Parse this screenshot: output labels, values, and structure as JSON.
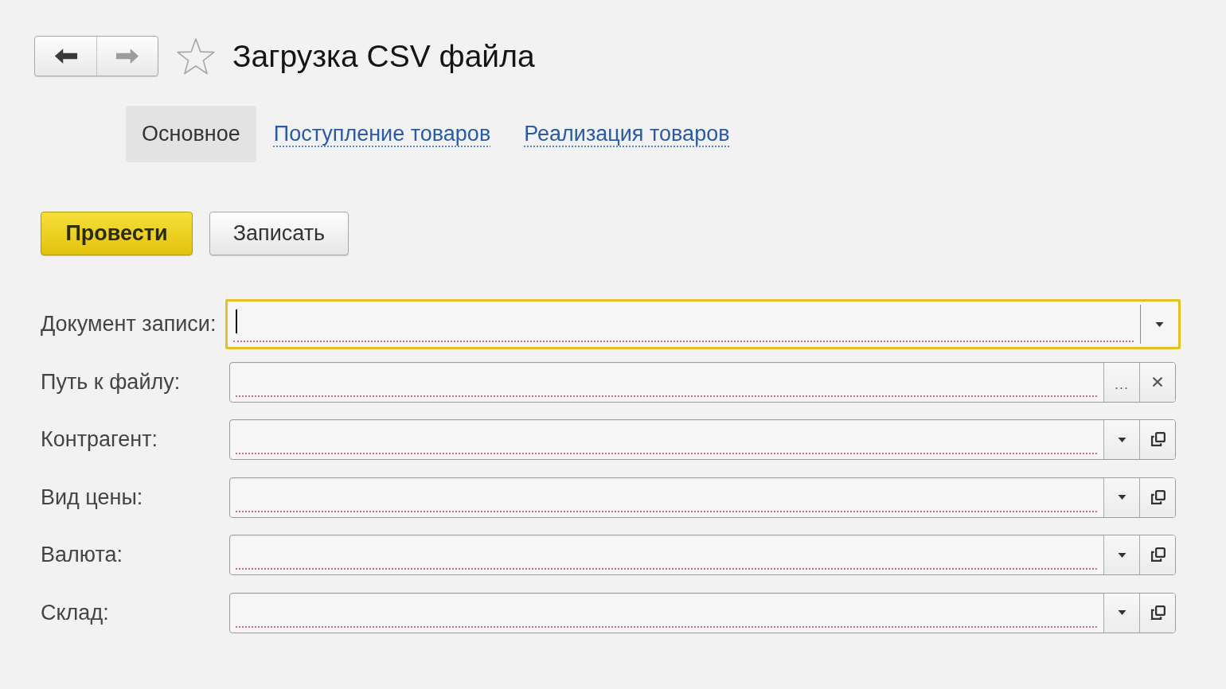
{
  "navigation": [
    {
      "kind": "back",
      "disabled": false
    },
    {
      "kind": "forward",
      "disabled": true
    }
  ],
  "favorite": false,
  "title": "Загрузка CSV файла",
  "tabs": [
    {
      "label": "Основное",
      "selected": true
    },
    {
      "label": "Поступление товаров",
      "selected": false
    },
    {
      "label": "Реализация товаров",
      "selected": false
    }
  ],
  "buttons": [
    {
      "label": "Провести",
      "default": true
    },
    {
      "label": "Записать",
      "default": false
    }
  ],
  "fields": [
    {
      "label": "Документ записи:",
      "kind": "select",
      "focused": true,
      "required": true
    },
    {
      "label": "Путь к файлу:",
      "kind": "file",
      "browse_label": "...",
      "focused": false,
      "required": true
    },
    {
      "label": "Контрагент:",
      "kind": "reference",
      "focused": false,
      "required": true
    },
    {
      "label": "Вид цены:",
      "kind": "reference",
      "focused": false,
      "required": true
    },
    {
      "label": "Валюта:",
      "kind": "reference",
      "focused": false,
      "required": true
    },
    {
      "label": "Склад:",
      "kind": "reference",
      "focused": false,
      "required": true
    }
  ]
}
